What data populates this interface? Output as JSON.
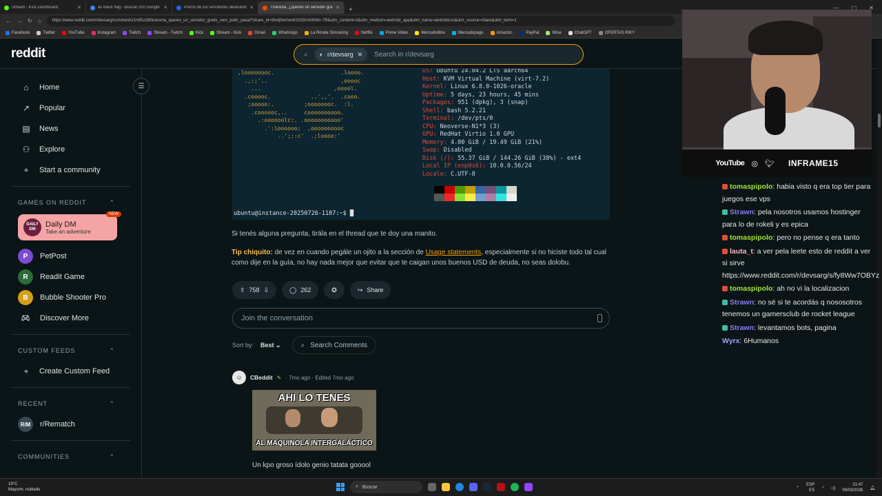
{
  "browser": {
    "tabs": [
      {
        "label": "Stream - Kick Dashboard",
        "color": "#53fc18"
      },
      {
        "label": "ac black flag - Buscar con Google",
        "color": "#4285f4"
      },
      {
        "label": "Precio de los servidores dedicados",
        "color": "#1c64f2"
      },
      {
        "label": "Troesma, ¿queres un servidor gratis?",
        "color": "#ff4500"
      }
    ],
    "url": "https://www.reddit.com/r/devsarg/comments/1mffsz38/troesma_queres_un_servidor_gratis_veni_pollo_pasa/?share_id=Wwij5wVwvKGG5UmWWv-7R&utm_content=2&utm_medium=android_app&utm_name=androidcss&utm_source=share&utm_term=1",
    "bookmarks": [
      {
        "label": "Facebook",
        "color": "#1877f2"
      },
      {
        "label": "Twitter",
        "color": "#cccccc"
      },
      {
        "label": "YouTube",
        "color": "#ff0000"
      },
      {
        "label": "Instagram",
        "color": "#e1306c"
      },
      {
        "label": "Twitch",
        "color": "#9146ff"
      },
      {
        "label": "Stream - Twitch",
        "color": "#9146ff"
      },
      {
        "label": "Kick",
        "color": "#53fc18"
      },
      {
        "label": "Stream - Kick",
        "color": "#53fc18"
      },
      {
        "label": "Gmail",
        "color": "#ea4335"
      },
      {
        "label": "WhatsApp",
        "color": "#25d366"
      },
      {
        "label": "La Ronda Simracing",
        "color": "#f4b400"
      },
      {
        "label": "Netflix",
        "color": "#e50914"
      },
      {
        "label": "Prime Video",
        "color": "#00a8e1"
      },
      {
        "label": "Mercadolibre",
        "color": "#ffe600"
      },
      {
        "label": "Mercadopago",
        "color": "#00b1ea"
      },
      {
        "label": "Amazon.",
        "color": "#ff9900"
      },
      {
        "label": "PayPal",
        "color": "#003087"
      },
      {
        "label": "Wise",
        "color": "#9fe870"
      },
      {
        "label": "ChatGPT",
        "color": "#dddddd"
      },
      {
        "label": "OFERTAS RIKY",
        "color": "#888888"
      }
    ]
  },
  "header": {
    "logo": "reddit",
    "search_chip": "r/devsarg",
    "search_placeholder": "Search in r/devsarg"
  },
  "sidebar": {
    "nav": [
      {
        "label": "Home",
        "icon": "⌂"
      },
      {
        "label": "Popular",
        "icon": "↗"
      },
      {
        "label": "News",
        "icon": "▤"
      },
      {
        "label": "Explore",
        "icon": "⚇"
      },
      {
        "label": "Start a community",
        "icon": "+"
      }
    ],
    "games_title": "GAMES ON REDDIT",
    "daily": {
      "title": "Daily DM",
      "subtitle": "Take an adventure",
      "badge": "NEW",
      "logo": "DAILY DM"
    },
    "games": [
      {
        "label": "PetPost",
        "color": "#7b4bd1"
      },
      {
        "label": "Readit Game",
        "color": "#2d6b3a"
      },
      {
        "label": "Bubble Shooter Pro",
        "color": "#d4a017"
      },
      {
        "label": "Discover More",
        "color": "#0b1416"
      }
    ],
    "custom_title": "CUSTOM FEEDS",
    "create_feed": "Create Custom Feed",
    "recent_title": "RECENT",
    "recent_item": "r/Rematch",
    "communities_title": "COMMUNITIES"
  },
  "terminal": {
    "ascii": [
      ",loooooooc.                    .loooo.",
      "  .,:;'..                      ,ooooc",
      "    ...                      ,ooool.",
      "  .cooooc.            ..',,'.  .cooo.",
      "   ;ooooo:.         ;oooooooc.  :l.",
      "    .coooooc,..     coooooooooo.",
      "      .:oooooolc:. .ooooooooooo'",
      "        .':loooooo;  ,oooooooooc",
      "            ..';::c'  .;loooo:'"
    ],
    "info": [
      {
        "k": "OS:",
        "v": " Ubuntu 24.04.2 LTS aarch64"
      },
      {
        "k": "Host:",
        "v": " KVM Virtual Machine (virt-7.2)"
      },
      {
        "k": "Kernel:",
        "v": " Linux 6.8.0-1026-oracle"
      },
      {
        "k": "Uptime:",
        "v": " 5 days, 23 hours, 45 mins"
      },
      {
        "k": "Packages:",
        "v": " 951 (dpkg), 3 (snap)"
      },
      {
        "k": "Shell:",
        "v": " bash 5.2.21"
      },
      {
        "k": "Terminal:",
        "v": " /dev/pts/0"
      },
      {
        "k": "CPU:",
        "v": " Neoverse-N1*3 (3)"
      },
      {
        "k": "GPU:",
        "v": " RedHat Virtio 1.0 GPU"
      },
      {
        "k": "Memory:",
        "v": " 4.00 GiB / 19.49 GiB (21%)"
      },
      {
        "k": "Swap:",
        "v": " Disabled"
      },
      {
        "k": "Disk (/):",
        "v": " 55.37 GiB / 144.26 GiB (38%) - ext4"
      },
      {
        "k": "Local IP (enp0s6):",
        "v": " 10.0.0.56/24"
      },
      {
        "k": "Locale:",
        "v": " C.UTF-8"
      }
    ],
    "swatch_colors": [
      "#000000",
      "#cc0000",
      "#4e9a06",
      "#c4a000",
      "#3465a4",
      "#75507b",
      "#06989a",
      "#d3d7cf",
      "#555753",
      "#ef2929",
      "#8ae234",
      "#fce94f",
      "#729fcf",
      "#ad7fa8",
      "#34e2e2",
      "#eeeeec"
    ],
    "prompt": "ubuntu@instance-20250726-1107:~$ █"
  },
  "post": {
    "paragraph1": "Si tenés alguna pregunta, tirála en el thread que te doy una manito.",
    "tip_label": "Tip chiquito:",
    "tip_pre": " de vez en cuando pegále un ojito a la sección de ",
    "tip_link": "Usage statements",
    "tip_post": ", especialmente si no hiciste todo tal cual como dije en la guía, no hay nada mejor que evitar que te caigan unos buenos USD de deuda, no seas dolobu.",
    "votes": "758",
    "comments": "262",
    "share": "Share",
    "join_placeholder": "Join the conversation",
    "sort_label": "Sort by:",
    "sort_value": "Best",
    "search_comments": "Search Comments"
  },
  "comment": {
    "author": "CBeddit",
    "time": "· 7mo ago · Edited 7mo ago",
    "meme_top": "AHI LO TENES",
    "meme_bottom": "AL MAQUINOLA INTERGALÁCTICO",
    "text": "Un kpo groso ídolo genio tatata gooool"
  },
  "stream": {
    "social_youtube": "YouTube",
    "brand": "INFRAME15",
    "chat": [
      {
        "user": "tomaspipolo",
        "color": "#a3e635",
        "badge": "#e04e3a",
        "text": ": habia visto q era top tier para juegos ese vps"
      },
      {
        "user": "Strawn",
        "color": "#8b7cf6",
        "badge": "#3ec0a0",
        "text": ": pela nosotros usamos hostinger para lo de rokeli y es epica"
      },
      {
        "user": "tomaspipolo",
        "color": "#a3e635",
        "badge": "#e04e3a",
        "text": ": pero no pense q era tanto"
      },
      {
        "user": "lauta_t",
        "color": "#f5b7c0",
        "badge": "#e04e3a",
        "text": ": a ver pela leete esto de reddit a ver si sirve https://www.reddit.com/r/devsarg/s/fy8Ww7OBYz"
      },
      {
        "user": "tomaspipolo",
        "color": "#a3e635",
        "badge": "#e04e3a",
        "text": ": ah no vi la localizacion"
      },
      {
        "user": "Strawn",
        "color": "#8b7cf6",
        "badge": "#3ec0a0",
        "text": ": no sé si te acordás q nososotros tenemos un gamersclub de rocket league"
      },
      {
        "user": "Strawn",
        "color": "#8b7cf6",
        "badge": "#3ec0a0",
        "text": ": levantamos bots, pagina"
      },
      {
        "user": "Wyrx",
        "color": "#9ca3ff",
        "badge": "",
        "text": ": 6Humanos"
      }
    ]
  },
  "taskbar": {
    "weather_temp": "19°C",
    "weather_desc": "Mayorm. nublado",
    "search": "Buscar",
    "lang1": "ESP",
    "lang2": "ES",
    "time": "21:47",
    "date": "09/03/2026"
  }
}
